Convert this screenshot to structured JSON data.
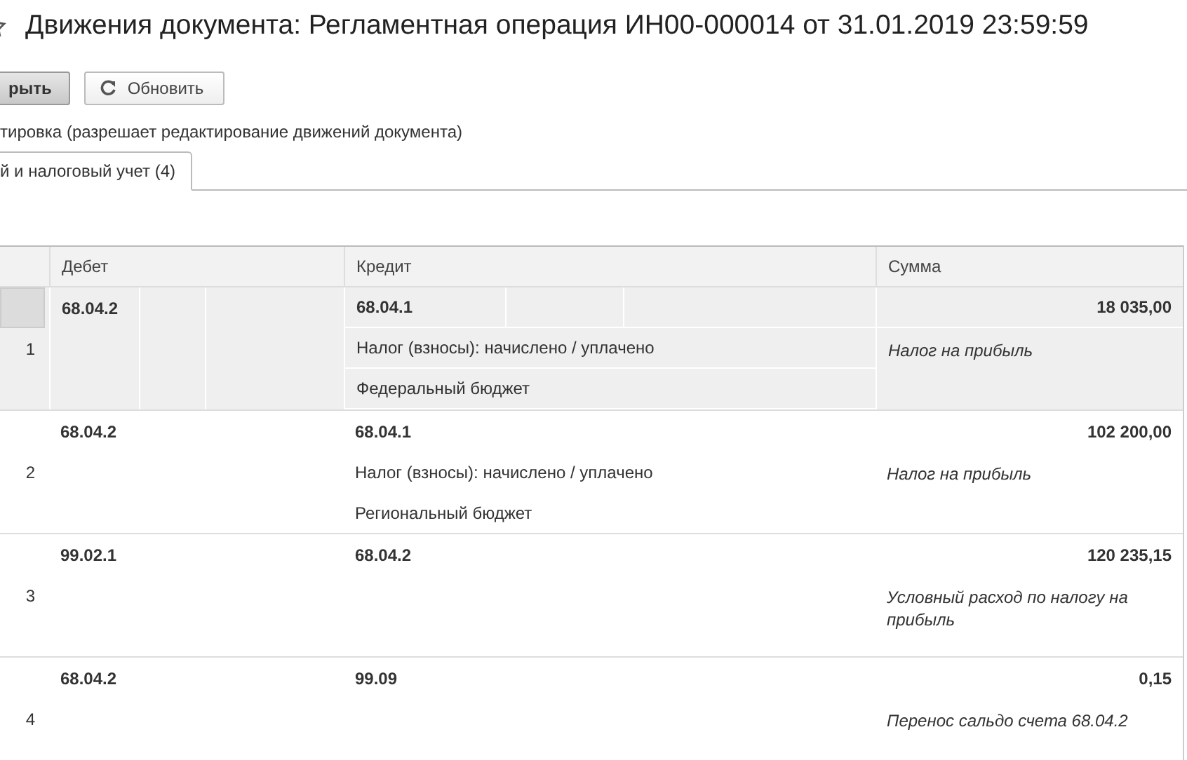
{
  "window": {
    "title": "Движения документа: Регламентная операция ИН00-000014 от 31.01.2019 23:59:59"
  },
  "toolbar": {
    "buttons": [
      {
        "label": "рыть",
        "kind": "primary"
      },
      {
        "label": "Обновить",
        "kind": "refresh"
      }
    ]
  },
  "edit_mode": {
    "label": "тировка (разрешает редактирование движений документа)"
  },
  "tabs": [
    {
      "label": "й и налоговый учет (4)",
      "selected": true
    }
  ],
  "table": {
    "columns": [
      "Дебет",
      "Кредит",
      "Сумма"
    ],
    "rows": [
      {
        "number": "1",
        "debit": "68.04.2",
        "credit": "68.04.1",
        "credit_subconto": [
          "Налог (взносы): начислено / уплачено",
          "Федеральный бюджет"
        ],
        "amount": "18 035,00",
        "content": "Налог на прибыль",
        "selected": true
      },
      {
        "number": "2",
        "debit": "68.04.2",
        "credit": "68.04.1",
        "credit_subconto": [
          "Налог (взносы): начислено / уплачено",
          "Региональный бюджет"
        ],
        "amount": "102 200,00",
        "content": "Налог на прибыль",
        "selected": false
      },
      {
        "number": "3",
        "debit": "99.02.1",
        "credit": "68.04.2",
        "credit_subconto": [],
        "amount": "120 235,15",
        "content": "Условный расход по налогу на прибыль",
        "selected": false
      },
      {
        "number": "4",
        "debit": "68.04.2",
        "credit": "99.09",
        "credit_subconto": [],
        "amount": "0,15",
        "content": "Перенос сальдо счета 68.04.2",
        "selected": false
      }
    ]
  }
}
